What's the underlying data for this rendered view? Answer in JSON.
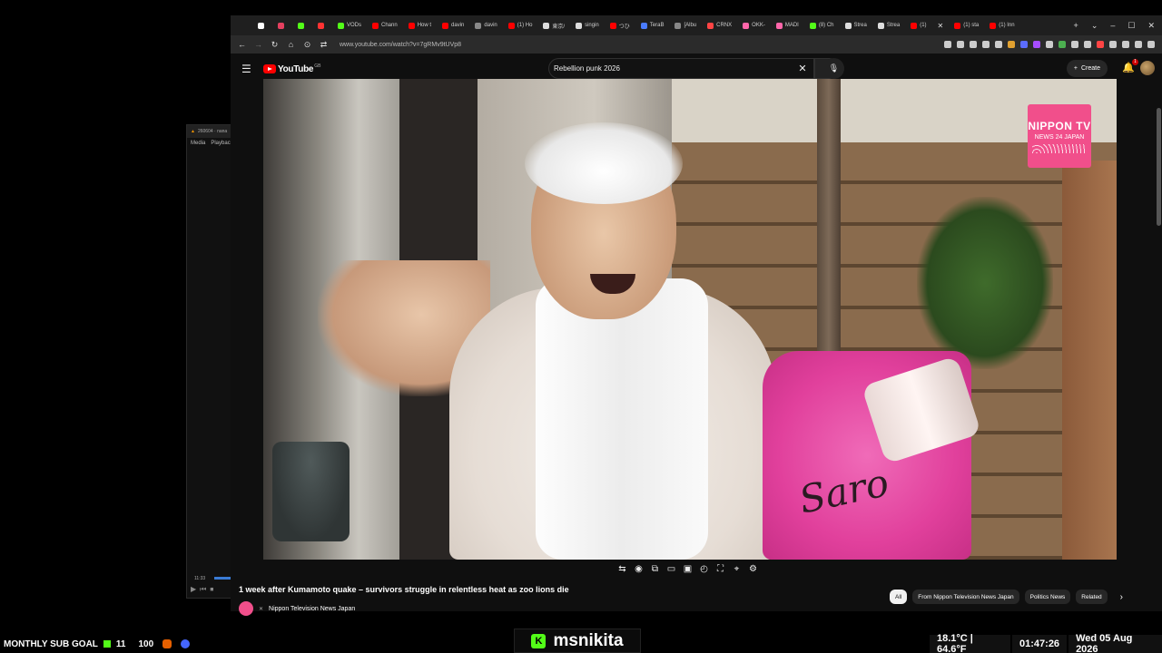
{
  "mini_player": {
    "title": "260604 · nana",
    "menu": [
      "Media",
      "Playback"
    ],
    "time": "11:33",
    "controls": [
      "▶",
      "⏮",
      "⏹"
    ]
  },
  "browser": {
    "tabs": [
      {
        "label": "",
        "color": "#ffffff",
        "icon": "x-icon"
      },
      {
        "label": "",
        "color": "#e4405f",
        "icon": "instagram-icon"
      },
      {
        "label": "",
        "color": "#53fc18",
        "icon": "kick-icon"
      },
      {
        "label": "",
        "color": "#ff3333",
        "icon": "yandex-icon"
      },
      {
        "label": "VODs",
        "color": "#53fc18",
        "icon": "kick-icon"
      },
      {
        "label": "Chann",
        "color": "#ff0000",
        "icon": "youtube-icon"
      },
      {
        "label": "How t",
        "color": "#ff0000",
        "icon": "youtube-icon"
      },
      {
        "label": "davin",
        "color": "#ff0000",
        "icon": "youtube-icon"
      },
      {
        "label": "davin",
        "color": "#888888",
        "icon": "page-icon"
      },
      {
        "label": "(1) Ho",
        "color": "#ff0000",
        "icon": "youtube-icon"
      },
      {
        "label": "東京/",
        "color": "#dddddd",
        "icon": "globe-icon"
      },
      {
        "label": "singin",
        "color": "#dddddd",
        "icon": "globe-icon"
      },
      {
        "label": "つひ",
        "color": "#ff0000",
        "icon": "youtube-icon"
      },
      {
        "label": "TeraB",
        "color": "#4a7cff",
        "icon": "terabox-icon"
      },
      {
        "label": "[Albu",
        "color": "#888888",
        "icon": "page-icon"
      },
      {
        "label": "CRNX",
        "color": "#ff4444",
        "icon": "globe-icon"
      },
      {
        "label": "OKK-",
        "color": "#ff66aa",
        "icon": "globe-icon"
      },
      {
        "label": "MADI",
        "color": "#ff66aa",
        "icon": "globe-icon"
      },
      {
        "label": "(8) Ch",
        "color": "#53fc18",
        "icon": "kick-icon"
      },
      {
        "label": "Strea",
        "color": "#dddddd",
        "icon": "globe-icon"
      },
      {
        "label": "Strea",
        "color": "#dddddd",
        "icon": "globe-icon"
      },
      {
        "label": "(1)",
        "color": "#ff0000",
        "icon": "youtube-icon"
      },
      {
        "label": "(1) sta",
        "color": "#ff0000",
        "icon": "youtube-icon"
      },
      {
        "label": "(1) Inn",
        "color": "#ff0000",
        "icon": "youtube-icon"
      }
    ],
    "url": "www.youtube.com/watch?v=7gRMv9tUVp8",
    "ext_colors": [
      "#cccccc",
      "#cccccc",
      "#cccccc",
      "#cccccc",
      "#cccccc",
      "#e0a030",
      "#5b6cff",
      "#a64dff",
      "#cccccc",
      "#4caf50",
      "#cccccc",
      "#cccccc",
      "#ff4444",
      "#cccccc",
      "#cccccc",
      "#cccccc",
      "#cccccc"
    ]
  },
  "youtube": {
    "logo": "YouTube",
    "logo_suffix": "GB",
    "search_value": "Rebellion punk 2026",
    "create_label": "Create",
    "notif_count": "1",
    "video": {
      "watermark_main": "NIPPON TV",
      "watermark_sub": "NEWS 24 JAPAN",
      "bag_text": "Saro"
    },
    "title": "1 week after Kumamoto quake – survivors struggle in relentless heat as zoo lions die",
    "channel": "Nippon Television News Japan",
    "chips": [
      {
        "label": "All",
        "active": true
      },
      {
        "label": "From Nippon Television News Japan",
        "active": false
      },
      {
        "label": "Politics News",
        "active": false
      },
      {
        "label": "Related",
        "active": false
      }
    ]
  },
  "overlay": {
    "sub_goal_label": "MONTHLY SUB GOAL",
    "sub_current": "11",
    "sub_target": "100",
    "streamer_name": "msnikita",
    "temperature": "18.1°C | 64.6°F",
    "clock": "01:47:26",
    "date": "Wed 05 Aug 2026"
  }
}
